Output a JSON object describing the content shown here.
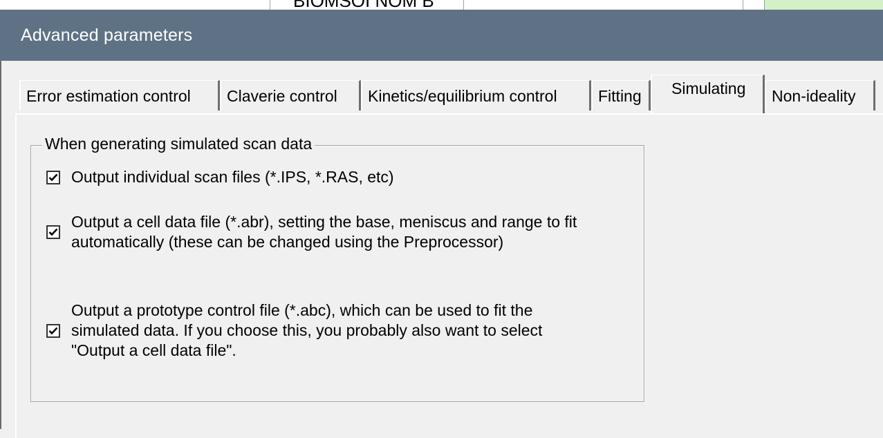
{
  "background": {
    "clipped_text": "BIOMSOI  NOM  B"
  },
  "window": {
    "title": "Advanced parameters",
    "titlebar_color": "#5f7285"
  },
  "tabs": [
    {
      "label": "Error estimation control",
      "active": false
    },
    {
      "label": "Claverie control",
      "active": false
    },
    {
      "label": "Kinetics/equilibrium control",
      "active": false
    },
    {
      "label": "Fitting",
      "active": false
    },
    {
      "label": "Simulating",
      "active": true
    },
    {
      "label": "Non-ideality",
      "active": false
    }
  ],
  "group": {
    "title": "When generating simulated scan data",
    "options": [
      {
        "label": "Output individual scan files (*.IPS, *.RAS, etc)",
        "checked": true
      },
      {
        "label": "Output a cell data file (*.abr), setting the base, meniscus and range to fit automatically (these can be changed using the Preprocessor)",
        "checked": true
      },
      {
        "label": "Output a prototype control file (*.abc), which can be used to fit the simulated data. If you choose this, you probably also want to select \"Output a cell data file\".",
        "checked": true
      }
    ]
  },
  "icons": {
    "checkmark": "checkmark-icon"
  }
}
